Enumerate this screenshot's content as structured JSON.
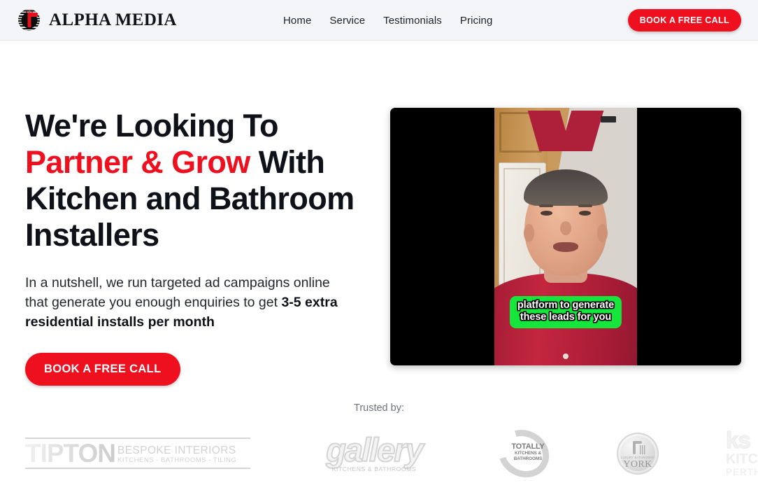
{
  "brand": {
    "name": "ALPHA MEDIA",
    "mark": "hammer-emblem"
  },
  "nav": {
    "items": [
      {
        "label": "Home"
      },
      {
        "label": "Service"
      },
      {
        "label": "Testimonials"
      },
      {
        "label": "Pricing"
      }
    ],
    "cta_label": "BOOK A FREE CALL"
  },
  "hero": {
    "headline_line1": "We're Looking To",
    "headline_accent": "Partner & Grow",
    "headline_line2_rest": " With",
    "headline_line3": "Kitchen and Bathroom",
    "headline_line4": "Installers",
    "sub_prefix": "In a nutshell, we run targeted ad campaigns online that generate you enough enquiries to get ",
    "sub_bold": "3-5 extra residential installs per month",
    "cta_label": "BOOK A FREE CALL"
  },
  "video": {
    "caption_line1": "platform to generate",
    "caption_line2": "these leads for you",
    "caption_bg": "#16e53c",
    "letterbox_color": "#000000"
  },
  "trusted": {
    "label": "Trusted by:",
    "logos": [
      {
        "name": "tipton",
        "word": "TIPTON",
        "line1": "BESPOKE INTERIORS",
        "line2": "KITCHENS - BATHROOMS - TILING"
      },
      {
        "name": "gallery",
        "word": "gallery",
        "sub": "KITCHENS & BATHROOMS"
      },
      {
        "name": "totally",
        "line1": "TOTALLY",
        "line2": "KITCHENS &",
        "line3": "BATHROOMS"
      },
      {
        "name": "york",
        "tiny": "LUXURY BATHROOMS",
        "word": "YORK"
      },
      {
        "name": "ks-kitchens-perth",
        "mark": "ks",
        "line1": "KITCH",
        "line2": "PERTH"
      }
    ]
  },
  "colors": {
    "accent_red": "#ee0f1f",
    "header_bg": "#f4f5f9",
    "text": "#0e1117"
  }
}
